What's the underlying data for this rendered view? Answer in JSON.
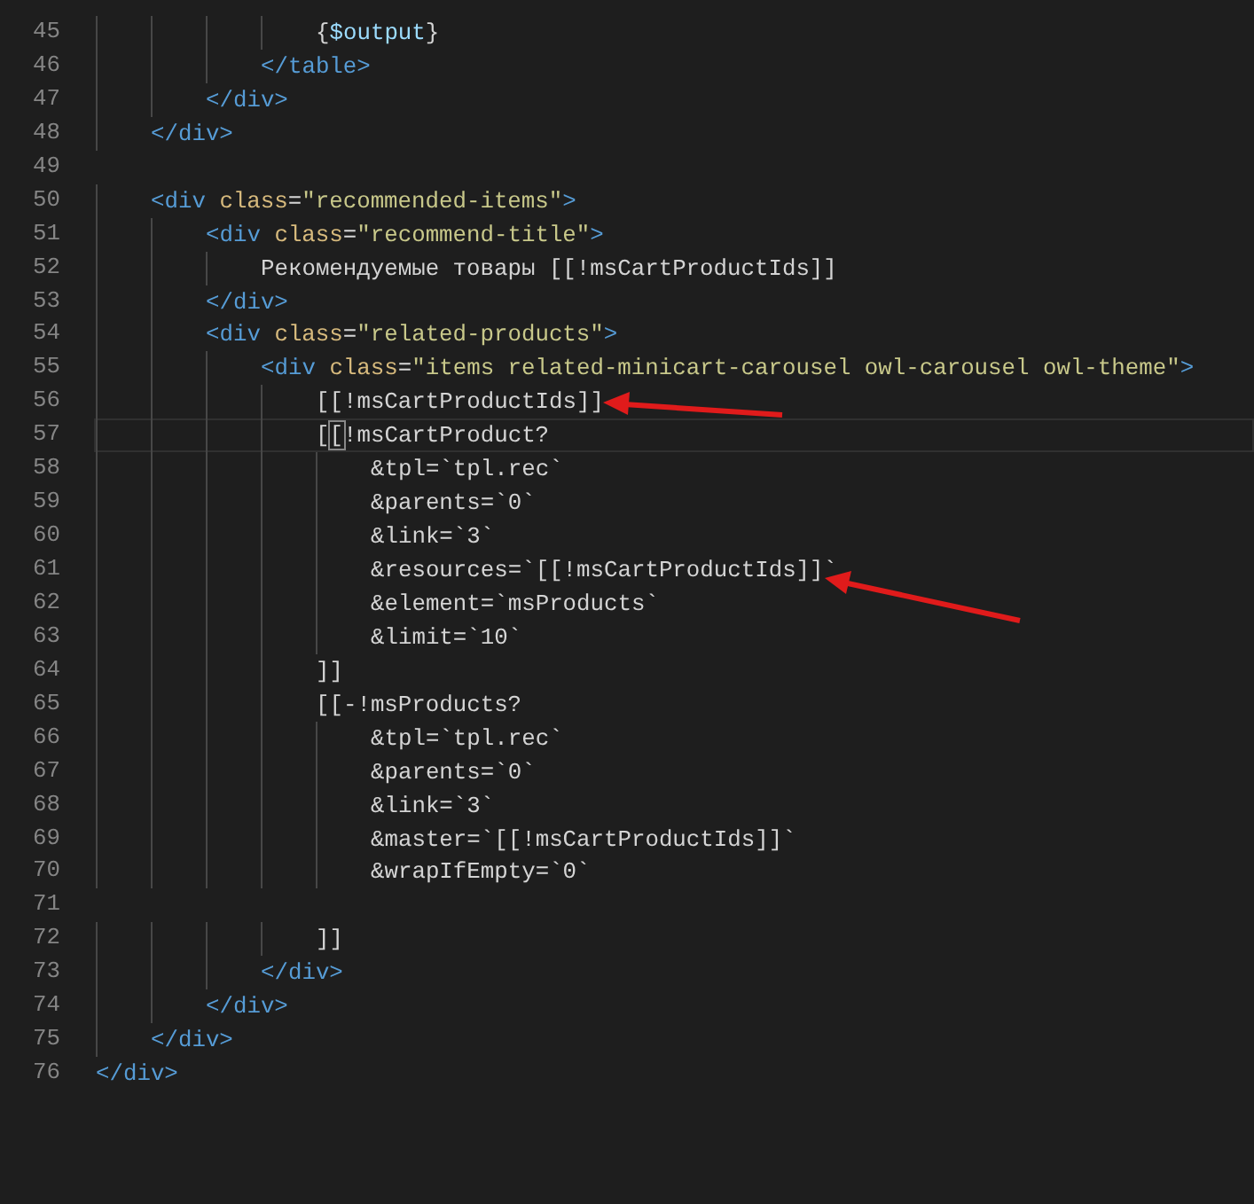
{
  "editor": {
    "lines": [
      {
        "number": "45",
        "current": false,
        "tokens": [
          {
            "kind": "plain",
            "text": "                {"
          },
          {
            "kind": "var",
            "text": "$output"
          },
          {
            "kind": "plain",
            "text": "}"
          }
        ]
      },
      {
        "number": "46",
        "current": false,
        "tokens": [
          {
            "kind": "tag",
            "text": "            </table>"
          }
        ]
      },
      {
        "number": "47",
        "current": false,
        "tokens": [
          {
            "kind": "tag",
            "text": "        </div>"
          }
        ]
      },
      {
        "number": "48",
        "current": false,
        "tokens": [
          {
            "kind": "tag",
            "text": "    </div>"
          }
        ]
      },
      {
        "number": "49",
        "current": false
      },
      {
        "number": "50",
        "current": false,
        "tokens": [
          {
            "kind": "tag",
            "text": "    <div"
          },
          {
            "kind": "attr",
            "text": "class"
          },
          {
            "kind": "plain",
            "text": "="
          },
          {
            "kind": "string",
            "text": "\"recommended-items\""
          },
          {
            "kind": "tag",
            "text": ">"
          }
        ]
      },
      {
        "number": "51",
        "current": false,
        "tokens": [
          {
            "kind": "tag",
            "text": "        <div"
          },
          {
            "kind": "attr",
            "text": "class"
          },
          {
            "kind": "plain",
            "text": "="
          },
          {
            "kind": "string",
            "text": "\"recommend-title\""
          },
          {
            "kind": "tag",
            "text": ">"
          }
        ]
      },
      {
        "number": "52",
        "current": false,
        "tokens": [
          {
            "kind": "plain",
            "text": "            Рекомендуемые товары [[!msCartProductIds]]"
          }
        ]
      },
      {
        "number": "53",
        "current": false,
        "tokens": [
          {
            "kind": "tag",
            "text": "        </div>"
          }
        ]
      },
      {
        "number": "54",
        "current": false,
        "tokens": [
          {
            "kind": "tag",
            "text": "        <div"
          },
          {
            "kind": "attr",
            "text": "class"
          },
          {
            "kind": "plain",
            "text": "="
          },
          {
            "kind": "string",
            "text": "\"related-products\""
          },
          {
            "kind": "tag",
            "text": ">"
          }
        ]
      },
      {
        "number": "55",
        "current": false,
        "tokens": [
          {
            "kind": "tag",
            "text": "            <div"
          },
          {
            "kind": "attr",
            "text": "class"
          },
          {
            "kind": "plain",
            "text": "="
          },
          {
            "kind": "string",
            "text": "\"items related-minicart-carousel owl-carousel owl-theme\""
          },
          {
            "kind": "tag",
            "text": ">"
          }
        ]
      },
      {
        "number": "56",
        "current": false,
        "tokens": [
          {
            "kind": "plain",
            "text": "                [[!msCartProductIds]]"
          }
        ]
      },
      {
        "number": "57",
        "current": true,
        "tokens": [
          {
            "kind": "plain",
            "text": "                ["
          },
          {
            "kind": "match",
            "text": "["
          },
          {
            "kind": "plain",
            "text": "!msCartProduct?"
          }
        ]
      },
      {
        "number": "58",
        "current": false,
        "tokens": [
          {
            "kind": "plain",
            "text": "                    &tpl=`tpl.rec`"
          }
        ]
      },
      {
        "number": "59",
        "current": false,
        "tokens": [
          {
            "kind": "plain",
            "text": "                    &parents=`0`"
          }
        ]
      },
      {
        "number": "60",
        "current": false,
        "tokens": [
          {
            "kind": "plain",
            "text": "                    &link=`3`"
          }
        ]
      },
      {
        "number": "61",
        "current": false,
        "tokens": [
          {
            "kind": "plain",
            "text": "                    &resources=`[[!msCartProductIds]]`"
          }
        ]
      },
      {
        "number": "62",
        "current": false,
        "tokens": [
          {
            "kind": "plain",
            "text": "                    &element=`msProducts`"
          }
        ]
      },
      {
        "number": "63",
        "current": false,
        "tokens": [
          {
            "kind": "plain",
            "text": "                    &limit=`10`"
          }
        ]
      },
      {
        "number": "64",
        "current": false,
        "tokens": [
          {
            "kind": "plain",
            "text": "                ]]"
          }
        ]
      },
      {
        "number": "65",
        "current": false,
        "tokens": [
          {
            "kind": "plain",
            "text": "                [[-!msProducts?"
          }
        ]
      },
      {
        "number": "66",
        "current": false,
        "tokens": [
          {
            "kind": "plain",
            "text": "                    &tpl=`tpl.rec`"
          }
        ]
      },
      {
        "number": "67",
        "current": false,
        "tokens": [
          {
            "kind": "plain",
            "text": "                    &parents=`0`"
          }
        ]
      },
      {
        "number": "68",
        "current": false,
        "tokens": [
          {
            "kind": "plain",
            "text": "                    &link=`3`"
          }
        ]
      },
      {
        "number": "69",
        "current": false,
        "tokens": [
          {
            "kind": "plain",
            "text": "                    &master=`[[!msCartProductIds]]`"
          }
        ]
      },
      {
        "number": "70",
        "current": false,
        "tokens": [
          {
            "kind": "plain",
            "text": "                    &wrapIfEmpty=`0`"
          }
        ]
      },
      {
        "number": "71",
        "current": false
      },
      {
        "number": "72",
        "current": false,
        "tokens": [
          {
            "kind": "plain",
            "text": "                ]]"
          }
        ]
      },
      {
        "number": "73",
        "current": false,
        "tokens": [
          {
            "kind": "tag",
            "text": "            </div>"
          }
        ]
      },
      {
        "number": "74",
        "current": false,
        "tokens": [
          {
            "kind": "tag",
            "text": "        </div>"
          }
        ]
      },
      {
        "number": "75",
        "current": false,
        "tokens": [
          {
            "kind": "tag",
            "text": "    </div>"
          }
        ]
      },
      {
        "number": "76",
        "current": false,
        "tokens": [
          {
            "kind": "tag",
            "text": "</div>"
          }
        ]
      }
    ]
  }
}
